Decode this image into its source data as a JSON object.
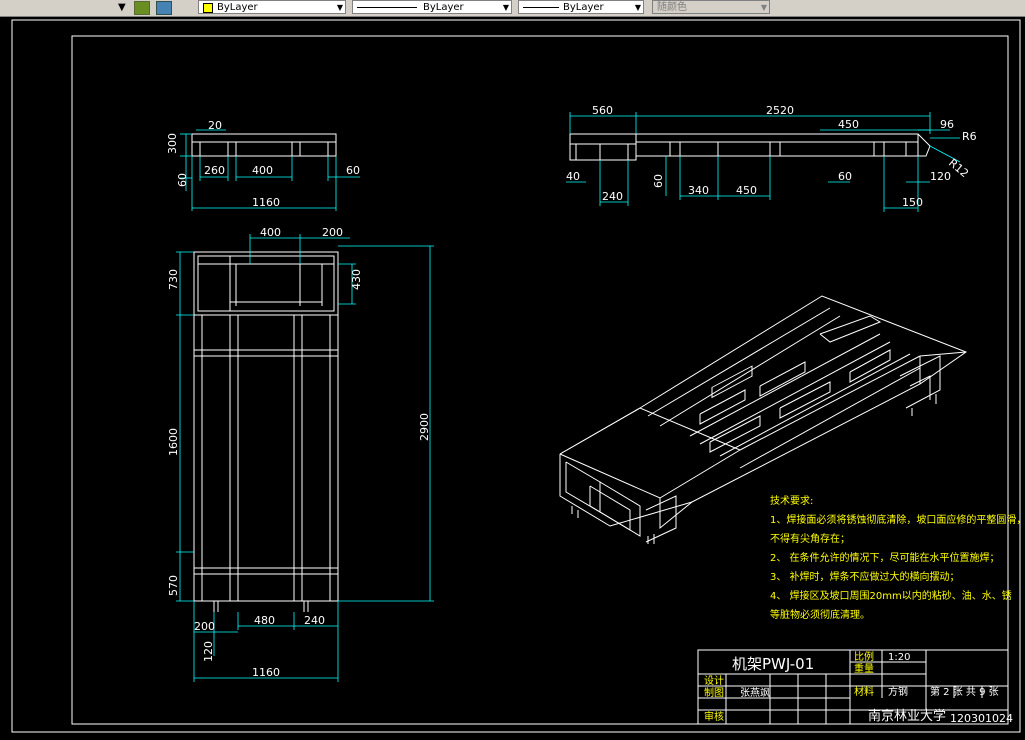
{
  "toolbar": {
    "color_combo": "ByLayer",
    "linetype_combo": "ByLayer",
    "lineweight_combo": "ByLayer",
    "plotstyle_combo": "随颜色"
  },
  "dims": {
    "top_view": [
      "20",
      "300",
      "60",
      "260",
      "400",
      "60",
      "1160"
    ],
    "plan_view": [
      "400",
      "200",
      "730",
      "430",
      "1600",
      "2900",
      "570",
      "200",
      "480",
      "240",
      "120",
      "1160"
    ],
    "side_view": [
      "560",
      "2520",
      "450",
      "96",
      "R6",
      "R12",
      "40",
      "240",
      "60",
      "340",
      "450",
      "60",
      "120",
      "150"
    ]
  },
  "tech_requirements": {
    "heading": "技术要求:",
    "lines": [
      "1、焊接面必须将锈蚀彻底清除，坡口面应修的平整圆滑，",
      "不得有尖角存在；",
      "2、 在条件允许的情况下，尽可能在水平位置施焊；",
      "3、 补焊时，焊条不应做过大的横向摆动；",
      "4、 焊接区及坡口周围20mm以内的粘砂、油、水、锈",
      "等脏物必须彻底清理。"
    ]
  },
  "title_block": {
    "drawing_name": "机架PWJ-01",
    "scale_label": "比例",
    "scale_value": "1:20",
    "weight_label": "重量",
    "material_label": "材料",
    "material_value": "方钢",
    "sheet_info": "第 2 张 共 9 张",
    "design_label": "设计",
    "drawn_label": "制图",
    "drawn_by": "张燕飒",
    "check_label": "审核",
    "school": "南京林业大学",
    "student_id": "120301024"
  }
}
